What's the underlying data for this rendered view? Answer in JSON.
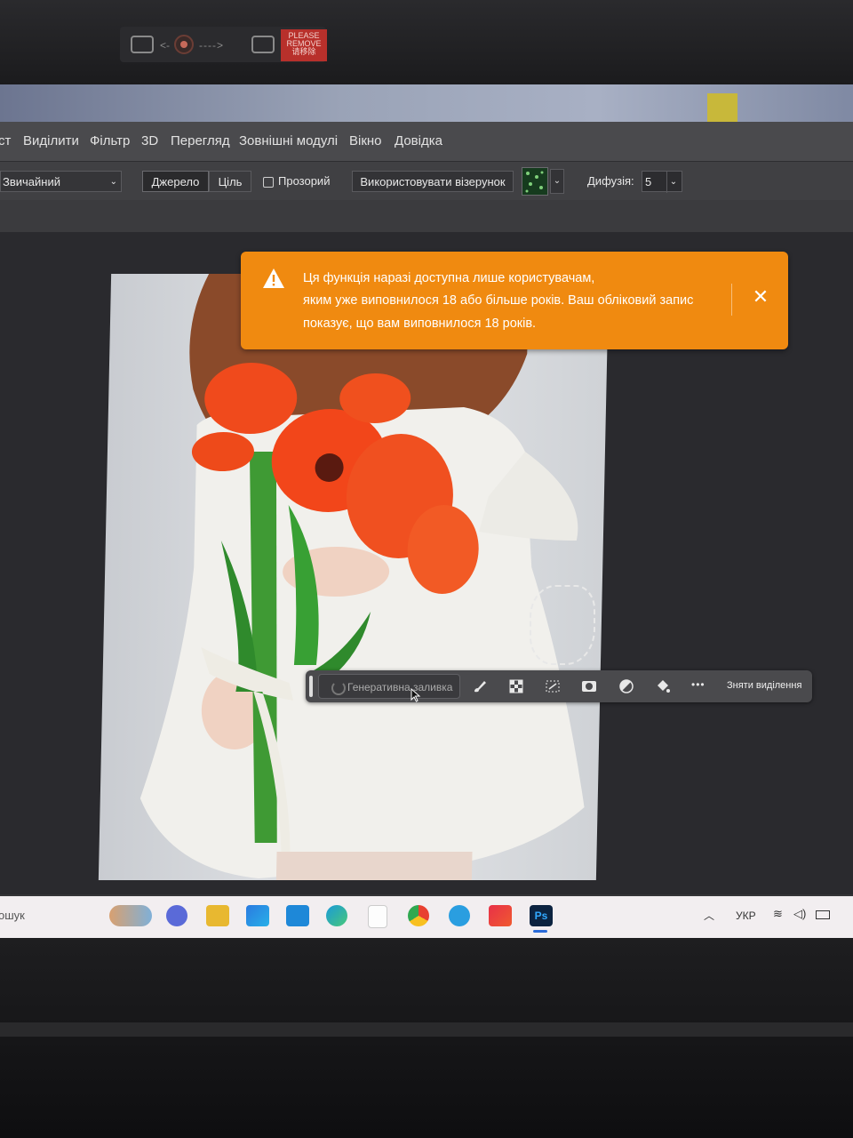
{
  "bezel": {
    "sticker_lines": [
      "PLEASE",
      "REMOVE",
      "请移除"
    ]
  },
  "menu": {
    "items": [
      "ст",
      "Виділити",
      "Фільтр",
      "3D",
      "Перегляд",
      "Зовнішні модулі",
      "Вікно",
      "Довідка"
    ]
  },
  "options": {
    "mode": "Звичайний",
    "source": "Джерело",
    "destination": "Ціль",
    "transparent": "Прозорий",
    "use_pattern": "Використовувати візерунок",
    "diffusion_label": "Дифузія:",
    "diffusion_value": "5"
  },
  "toast": {
    "lines": [
      "Ця функція наразі доступна лише користувачам,",
      "яким уже виповнилося 18 або більше років. Ваш обліковий запис",
      "показує, що вам виповнилося 18 років."
    ],
    "close": "✕"
  },
  "context_bar": {
    "generative_fill": "Генеративна заливка",
    "more": "•••",
    "deselect": "Зняти виділення"
  },
  "taskbar": {
    "search": "ошук",
    "language": "УКР",
    "app_active": "Ps"
  },
  "colors": {
    "toast": "#f08a10",
    "tulip": "#f2461a",
    "dress": "#f1f0ec"
  }
}
